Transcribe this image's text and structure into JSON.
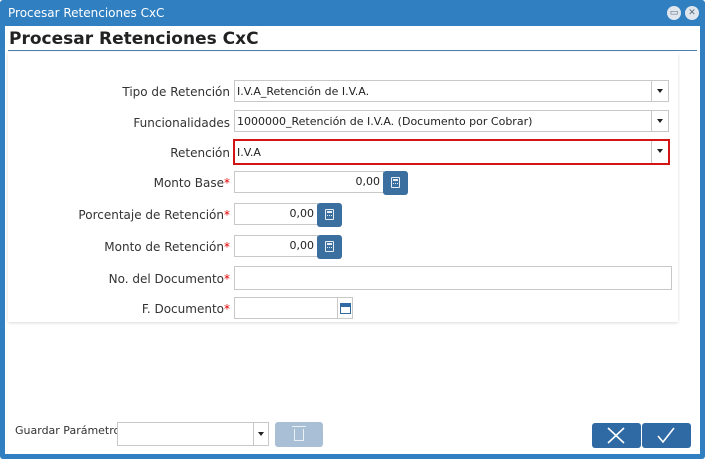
{
  "window": {
    "title": "Procesar Retenciones CxC",
    "header": "Procesar Retenciones CxC"
  },
  "form": {
    "tipo_retencion": {
      "label": "Tipo de Retención",
      "value": "I.V.A_Retención de I.V.A."
    },
    "funcionalidades": {
      "label": "Funcionalidades",
      "value": "1000000_Retención de I.V.A. (Documento por Cobrar)"
    },
    "retencion": {
      "label": "Retención",
      "value": "I.V.A"
    },
    "monto_base": {
      "label": "Monto Base",
      "required": "*",
      "value": "0,00"
    },
    "porcentaje_retencion": {
      "label": "Porcentaje de Retención",
      "required": "*",
      "value": "0,00"
    },
    "monto_retencion": {
      "label": "Monto de Retención",
      "required": "*",
      "value": "0,00"
    },
    "no_documento": {
      "label": "No. del Documento",
      "required": "*",
      "value": ""
    },
    "f_documento": {
      "label": "F. Documento",
      "required": "*",
      "value": ""
    }
  },
  "footer": {
    "guardar_parametro_label": "Guardar Parámetro",
    "guardar_parametro_value": ""
  },
  "icons": {
    "maximize": "maximize-icon",
    "close": "close-icon",
    "calculator": "calculator-icon",
    "calendar": "calendar-icon",
    "trash": "trash-icon",
    "cancel": "x-icon",
    "ok": "check-icon",
    "dropdown": "chevron-down-icon"
  },
  "colors": {
    "titlebar": "#2f7fc1",
    "button": "#2f6aa5",
    "highlight": "#d21414",
    "required": "#dd0000"
  }
}
